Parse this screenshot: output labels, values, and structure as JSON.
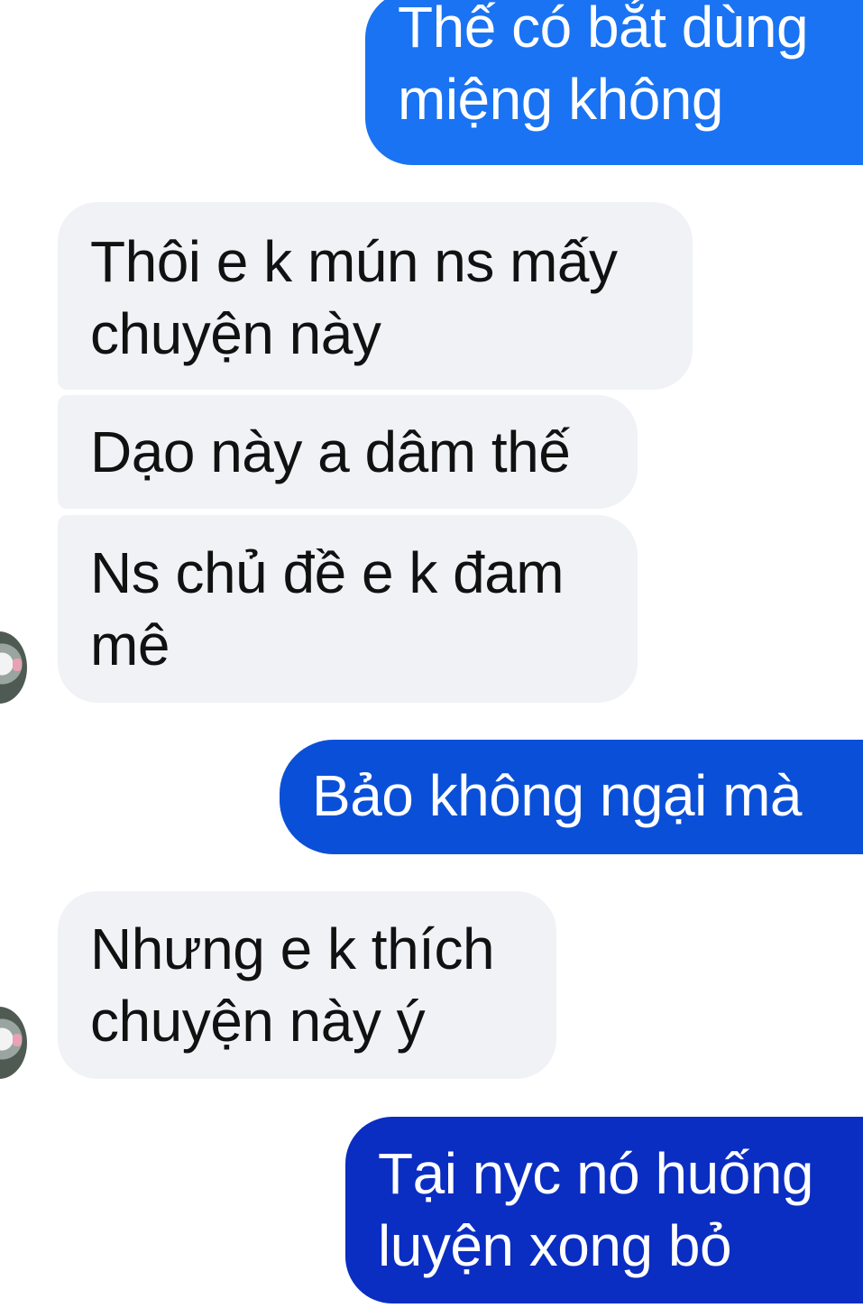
{
  "conversation": {
    "messages": [
      {
        "direction": "sent",
        "lines": [
          "Thế có bắt dùng",
          "miệng không"
        ]
      },
      {
        "direction": "received",
        "lines": [
          "Thôi e k mún ns mấy",
          "chuyện này"
        ]
      },
      {
        "direction": "received",
        "lines": [
          "Dạo này a dâm thế"
        ]
      },
      {
        "direction": "received",
        "lines": [
          "Ns chủ đề e k đam",
          "mê"
        ]
      },
      {
        "direction": "sent",
        "lines": [
          "Bảo không ngại mà"
        ]
      },
      {
        "direction": "received",
        "lines": [
          "Nhưng e k thích",
          "chuyện này ý"
        ]
      },
      {
        "direction": "sent",
        "lines": [
          "Tại nyc nó huống",
          "luyện xong bỏ"
        ]
      }
    ]
  },
  "colors": {
    "sent_bubble_top": "#1a73f2",
    "sent_bubble_mid": "#0a4fd8",
    "sent_bubble_bottom": "#0a2dc2",
    "received_bubble": "#f1f2f6",
    "received_text": "#111111",
    "sent_text": "#ffffff"
  },
  "icons": {
    "avatar": "contact-avatar-icon"
  }
}
